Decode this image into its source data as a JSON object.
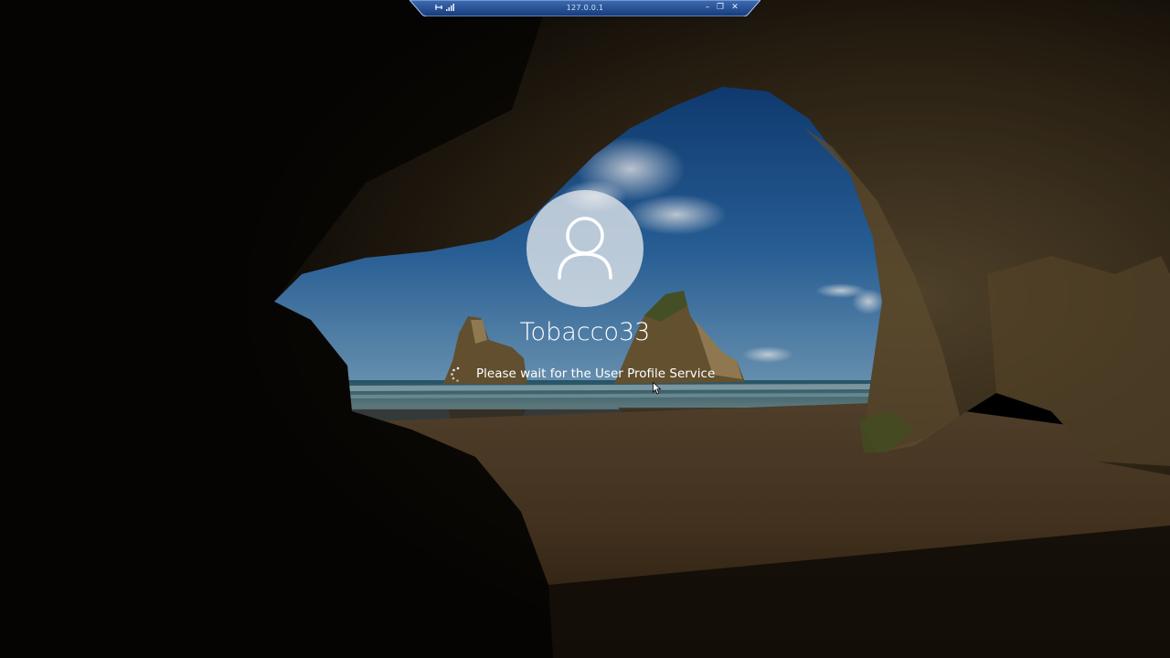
{
  "remote_desktop_bar": {
    "title": "127.0.0.1",
    "minimize_label": "–",
    "restore_label": "❐",
    "close_label": "✕",
    "pin_icon": "pin-icon",
    "signal_icon": "connection-quality-icon",
    "color": "#1b3d78"
  },
  "lock_screen": {
    "background": "cave-beach-wallpaper",
    "avatar_icon": "user-account-icon",
    "username": "Tobacco33",
    "status_message": "Please wait for the User Profile Service",
    "spinner_icon": "loading-spinner-icon"
  }
}
